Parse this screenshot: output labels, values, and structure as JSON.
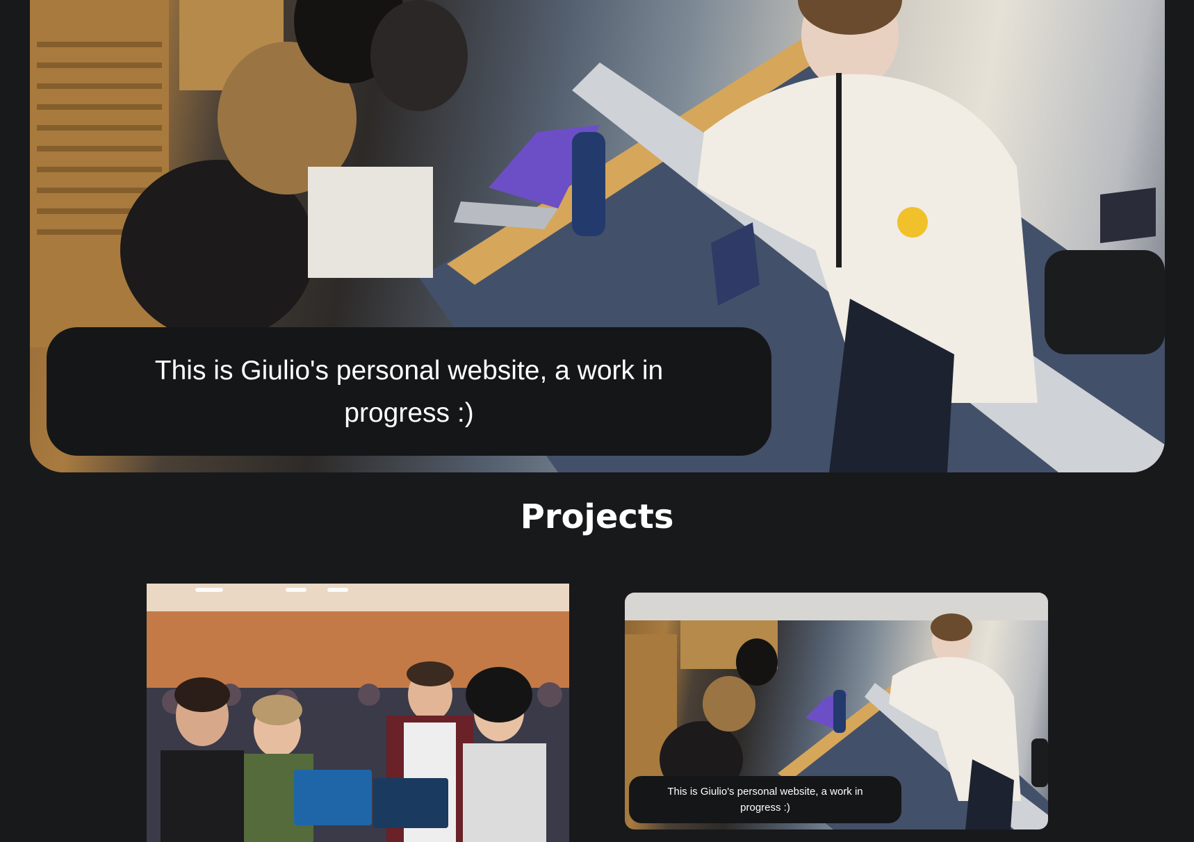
{
  "hero": {
    "caption": "This is Giulio's personal website, a work in progress :)"
  },
  "projects": {
    "title": "Projects",
    "cards": [
      {
        "image": "team-photo-with-laptops"
      },
      {
        "image": "classroom-photo",
        "caption": "This is Giulio's personal website, a work in progress :)"
      }
    ]
  }
}
